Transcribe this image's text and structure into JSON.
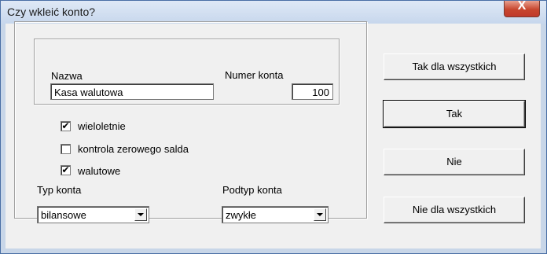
{
  "window": {
    "title": "Czy wkleić konto?",
    "close_label": "X"
  },
  "fields": {
    "name_label": "Nazwa",
    "name_value": "Kasa walutowa",
    "number_label": "Numer konta",
    "number_value": "100"
  },
  "checkboxes": [
    {
      "label": "wieloletnie",
      "checked": true,
      "mark": "✔"
    },
    {
      "label": "kontrola zerowego salda",
      "checked": false,
      "mark": ""
    },
    {
      "label": "walutowe",
      "checked": true,
      "mark": "✔"
    }
  ],
  "combos": {
    "type_label": "Typ konta",
    "type_value": "bilansowe",
    "subtype_label": "Podtyp konta",
    "subtype_value": "zwykłe"
  },
  "buttons": {
    "yes_all": "Tak dla wszystkich",
    "yes": "Tak",
    "no": "Nie",
    "no_all": "Nie dla wszystkich"
  }
}
